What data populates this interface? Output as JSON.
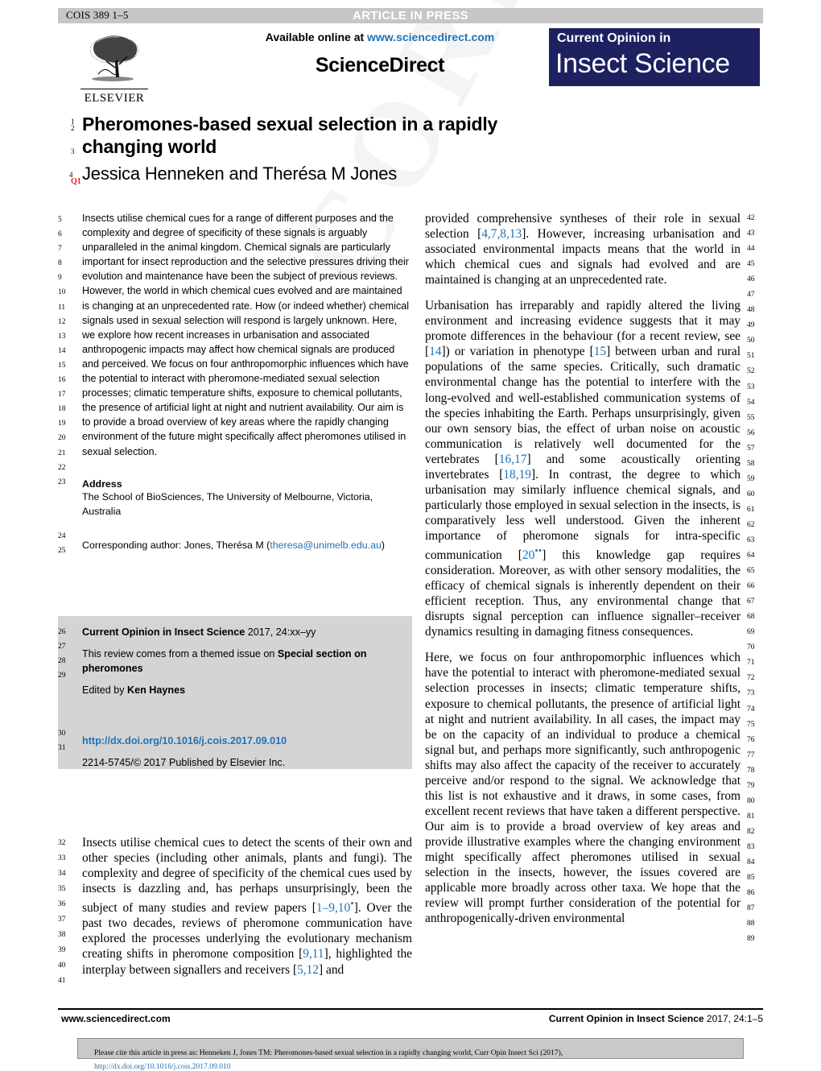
{
  "header": {
    "cois_code": "COIS 389 1–5",
    "article_in_press": "ARTICLE IN PRESS"
  },
  "masthead": {
    "available_online_prefix": "Available online at ",
    "available_online_url": "www.sciencedirect.com",
    "sciencedirect": "ScienceDirect",
    "publisher_wordmark": "ELSEVIER",
    "journal_logo_line1": "Current Opinion in",
    "journal_logo_line2": "Insect Science",
    "journal_logo_color": "#1d2160"
  },
  "article": {
    "title": "Pheromones-based sexual selection in a rapidly changing world",
    "authors": "Jessica Henneken and Therésa M Jones",
    "query_marker": "Q1",
    "title_line_numbers": [
      "1",
      "2",
      "3",
      "4"
    ]
  },
  "abstract": {
    "text": "Insects utilise chemical cues for a range of different purposes and the complexity and degree of specificity of these signals is arguably unparalleled in the animal kingdom. Chemical signals are particularly important for insect reproduction and the selective pressures driving their evolution and maintenance have been the subject of previous reviews. However, the world in which chemical cues evolved and are maintained is changing at an unprecedented rate. How (or indeed whether) chemical signals used in sexual selection will respond is largely unknown. Here, we explore how recent increases in urbanisation and associated anthropogenic impacts may affect how chemical signals are produced and perceived. We focus on four anthropomorphic influences which have the potential to interact with pheromone-mediated sexual selection processes; climatic temperature shifts, exposure to chemical pollutants, the presence of artificial light at night and nutrient availability. Our aim is to provide a broad overview of key areas where the rapidly changing environment of the future might specifically affect pheromones utilised in sexual selection.",
    "line_numbers": [
      "5",
      "6",
      "7",
      "8",
      "9",
      "10",
      "11",
      "12",
      "13",
      "14",
      "15",
      "16",
      "17",
      "18",
      "19",
      "20",
      "21",
      "22",
      "23"
    ]
  },
  "address": {
    "heading": "Address",
    "body": "The School of BioSciences, The University of Melbourne, Victoria, Australia",
    "line_numbers": [
      "24",
      "25"
    ],
    "corresponding_prefix": "Corresponding author: Jones, Therésa M (",
    "corresponding_email": "theresa@unimelb.edu.au",
    "corresponding_suffix": ")"
  },
  "meta_box": {
    "journal_ref_bold": "Current Opinion in Insect Science",
    "journal_ref_rest": " 2017, 24:xx–yy",
    "themed_prefix": "This review comes from a themed issue on ",
    "themed_bold": "Special section on pheromones",
    "edited_prefix": "Edited by ",
    "edited_bold": "Ken Haynes",
    "doi": "http://dx.doi.org/10.1016/j.cois.2017.09.010",
    "copyright": "2214-5745/© 2017 Published by Elsevier Inc.",
    "line_numbers": [
      "26",
      "27",
      "28",
      "29",
      "30",
      "31"
    ]
  },
  "left_body": {
    "paragraph_parts": [
      {
        "t": "Insects utilise chemical cues to detect the scents of their own and other species (including other animals, plants and fungi). The complexity and degree of specificity of the chemical cues used by insects is dazzling and, has perhaps unsurprisingly, been the subject of many studies and review papers ["
      },
      {
        "t": "1–9,10",
        "cite": true
      },
      {
        "t": "•",
        "cite": true,
        "sup": true
      },
      {
        "t": "]. Over the past two decades, reviews of pheromone communication have explored the processes underlying the evolutionary mechanism creating shifts in pheromone composition ["
      },
      {
        "t": "9,11",
        "cite": true
      },
      {
        "t": "], highlighted the interplay between signallers and receivers ["
      },
      {
        "t": "5,12",
        "cite": true
      },
      {
        "t": "] and"
      }
    ],
    "line_numbers": [
      "32",
      "33",
      "34",
      "35",
      "36",
      "37",
      "38",
      "39",
      "40",
      "41"
    ]
  },
  "right_body": {
    "paragraphs": [
      {
        "parts": [
          {
            "t": "provided comprehensive syntheses of their role in sexual selection ["
          },
          {
            "t": "4,7,8,13",
            "cite": true
          },
          {
            "t": "]. However, increasing urbanisation and associated environmental impacts means that the world in which chemical cues and signals had evolved and are maintained is changing at an unprecedented rate."
          }
        ]
      },
      {
        "parts": [
          {
            "t": "Urbanisation has irreparably and rapidly altered the living environment and increasing evidence suggests that it may promote differences in the behaviour (for a recent review, see ["
          },
          {
            "t": "14",
            "cite": true
          },
          {
            "t": "]) or variation in phenotype ["
          },
          {
            "t": "15",
            "cite": true
          },
          {
            "t": "] between urban and rural populations of the same species. Critically, such dramatic environmental change has the potential to interfere with the long-evolved and well-established communication systems of the species inhabiting the Earth. Perhaps unsurprisingly, given our own sensory bias, the effect of urban noise on acoustic communication is relatively well documented for the vertebrates ["
          },
          {
            "t": "16,17",
            "cite": true
          },
          {
            "t": "] and some acoustically orienting invertebrates ["
          },
          {
            "t": "18,19",
            "cite": true
          },
          {
            "t": "]. In contrast, the degree to which urbanisation may similarly influence chemical signals, and particularly those employed in sexual selection in the insects, is comparatively less well understood. Given the inherent importance of pheromone signals for intra-specific communication ["
          },
          {
            "t": "20",
            "cite": true
          },
          {
            "t": "••",
            "cite": true,
            "sup": true
          },
          {
            "t": "] this knowledge gap requires consideration. Moreover, as with other sensory modalities, the efficacy of chemical signals is inherently dependent on their efficient reception. Thus, any environmental change that disrupts signal perception can influence signaller–receiver dynamics resulting in damaging fitness consequences."
          }
        ]
      },
      {
        "parts": [
          {
            "t": "Here, we focus on four anthropomorphic influences which have the potential to interact with pheromone-mediated sexual selection processes in insects; climatic temperature shifts, exposure to chemical pollutants, the presence of artificial light at night and nutrient availability. In all cases, the impact may be on the capacity of an individual to produce a chemical signal but, and perhaps more significantly, such anthropogenic shifts may also affect the capacity of the receiver to accurately perceive and/or respond to the signal. We acknowledge that this list is not exhaustive and it draws, in some cases, from excellent recent reviews that have taken a different perspective. Our aim is to provide a broad overview of key areas and provide illustrative examples where the changing environment might specifically affect pheromones utilised in sexual selection in the insects, however, the issues covered are applicable more broadly across other taxa. We hope that the review will prompt further consideration of the potential for anthropogenically-driven environmental"
          }
        ]
      }
    ],
    "line_numbers": [
      "42",
      "43",
      "44",
      "45",
      "46",
      "47",
      "48",
      "49",
      "50",
      "51",
      "52",
      "53",
      "54",
      "55",
      "56",
      "57",
      "58",
      "59",
      "60",
      "61",
      "62",
      "63",
      "64",
      "65",
      "66",
      "67",
      "68",
      "69",
      "70",
      "71",
      "72",
      "73",
      "74",
      "75",
      "76",
      "77",
      "78",
      "79",
      "80",
      "81",
      "82",
      "83",
      "84",
      "85",
      "86",
      "87",
      "88",
      "89"
    ]
  },
  "footer": {
    "left": "www.sciencedirect.com",
    "right_bold": "Current Opinion in Insect Science",
    "right_rest": " 2017, 24:1–5",
    "cite_notice_prefix": "Please cite this article in press as: Henneken J, Jones  TM: Pheromones-based sexual selection in a rapidly changing world, Curr Opin Insect Sci (2017), ",
    "cite_notice_link": "http://dx.doi.org/10.1016/j.cois.2017.09.010"
  },
  "watermark": "CORRECTED PROOF"
}
